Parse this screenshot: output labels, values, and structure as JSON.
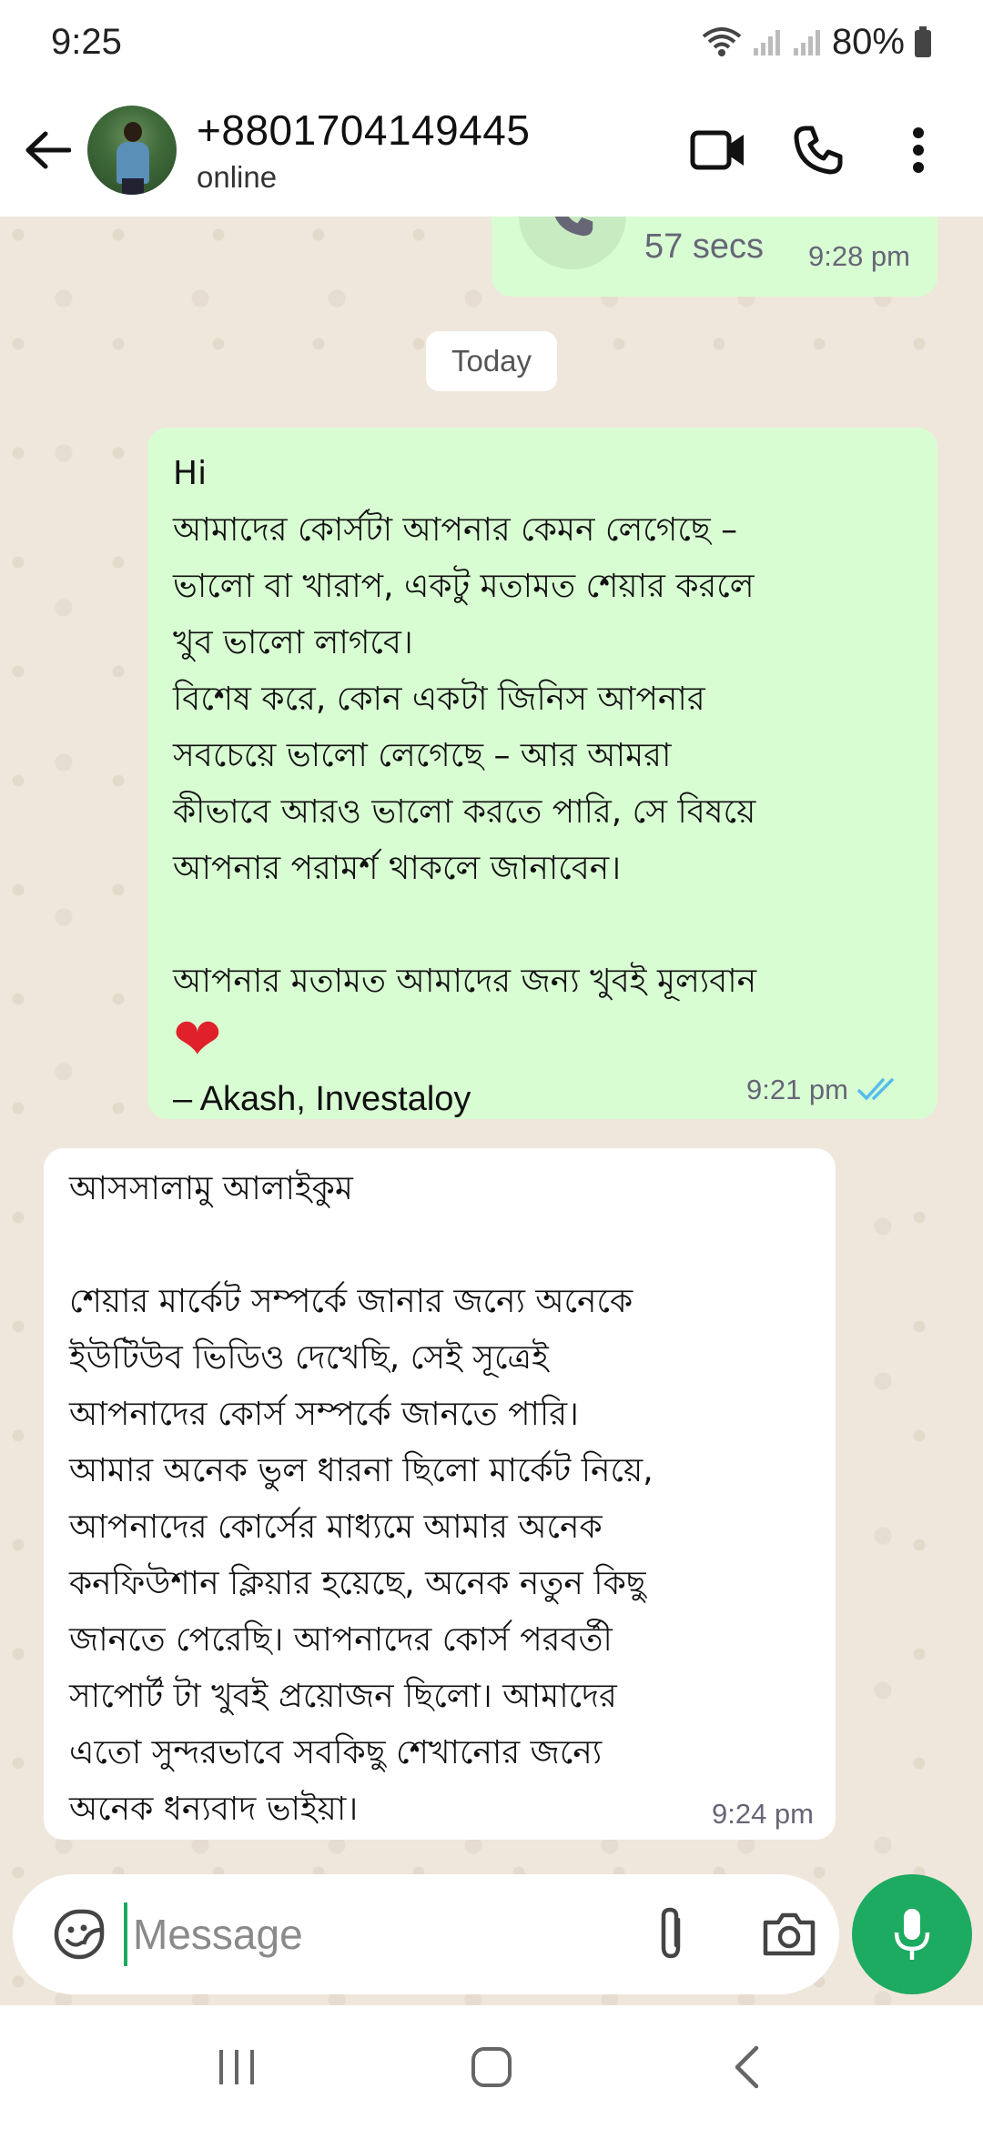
{
  "status_bar": {
    "time": "9:25",
    "battery": "80%",
    "icons": [
      "wifi-icon",
      "signal-icon",
      "signal-icon",
      "battery-icon"
    ]
  },
  "header": {
    "contact_name": "+8801704149445",
    "contact_status": "online",
    "actions": [
      "video-call-icon",
      "voice-call-icon",
      "more-options-icon"
    ]
  },
  "chat": {
    "call_message": {
      "duration": "57 secs",
      "time": "9:28 pm"
    },
    "date_separator": "Today",
    "messages": [
      {
        "direction": "out",
        "text": "Hi\nআমাদের কোর্সটা আপনার কেমন লেগেছে –\nভালো বা খারাপ, একটু মতামত শেয়ার করলে\nখুব ভালো লাগবে।\nবিশেষ করে, কোন একটা জিনিস আপনার\nসবচেয়ে ভালো লেগেছে – আর আমরা\nকীভাবে আরও ভালো করতে পারি, সে বিষয়ে\nআপনার পরামর্শ থাকলে জানাবেন।\n\nআপনার মতামত আমাদের জন্য খুবই মূল্যবান",
        "emoji": "❤",
        "signature": "– Akash, Investaloy",
        "time": "9:21 pm",
        "status": "read"
      },
      {
        "direction": "in",
        "text": "আসসালামু আলাইকুম\n\nশেয়ার মার্কেট সম্পর্কে জানার জন্যে অনেকে\nইউটিউব ভিডিও দেখেছি, সেই সূত্রেই\nআপনাদের কোর্স সম্পর্কে জানতে পারি।\nআমার অনেক ভুল ধারনা ছিলো মার্কেট নিয়ে,\nআপনাদের কোর্সের মাধ্যমে আমার অনেক\nকনফিউশান ক্লিয়ার হয়েছে, অনেক নতুন কিছু\nজানতে পেরেছি। আপনাদের কোর্স পরবর্তী\nসাপোর্ট টা খুবই প্রয়োজন ছিলো। আমাদের\nএতো সুন্দরভাবে সবকিছু শেখানোর জন্যে\nঅনেক ধন্যবাদ ভাইয়া।",
        "time": "9:24 pm"
      }
    ]
  },
  "composer": {
    "placeholder": "Message"
  },
  "colors": {
    "outgoing_bubble": "#d9fdd3",
    "incoming_bubble": "#ffffff",
    "chat_background": "#efe7dc",
    "accent": "#1daa61",
    "read_ticks": "#53bdeb"
  }
}
